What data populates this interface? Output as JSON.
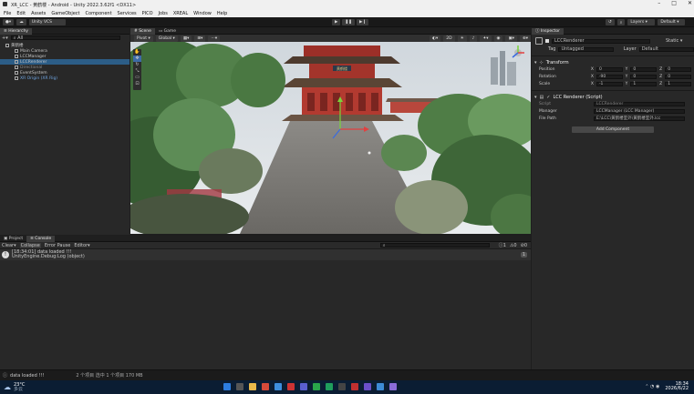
{
  "window": {
    "title": "XR_LCC - 黄鹤楼 - Android - Unity 2022.3.62f1 <DX11>"
  },
  "menu": [
    "File",
    "Edit",
    "Assets",
    "GameObject",
    "Component",
    "Services",
    "PICO",
    "Jobs",
    "XREAL",
    "Window",
    "Help"
  ],
  "toolbar": {
    "account": "Unity VCS",
    "layers": "Layers",
    "layout": "Default"
  },
  "hierarchy": {
    "tab": "Hierarchy",
    "search_placeholder": "All",
    "items": [
      {
        "label": "黄鹤楼",
        "depth": 0
      },
      {
        "label": "Main Camera",
        "depth": 1
      },
      {
        "label": "LCCManager",
        "depth": 1
      },
      {
        "label": "LCCRenderer",
        "depth": 1
      },
      {
        "label": "Directional",
        "depth": 1
      },
      {
        "label": "EventSystem",
        "depth": 1
      },
      {
        "label": "XR Origin (XR Rig)",
        "depth": 1
      }
    ]
  },
  "scene": {
    "tabs": [
      "Scene",
      "Game"
    ],
    "shading": "Pivot",
    "space": "Global",
    "persp": "< Persp",
    "sign_text": "黄鹤楼"
  },
  "inspector": {
    "tab": "Inspector",
    "object_name": "LCCRenderer",
    "static_label": "Static",
    "tag_label": "Tag",
    "tag_value": "Untagged",
    "layer_label": "Layer",
    "layer_value": "Default",
    "transform_title": "Transform",
    "position_label": "Position",
    "rotation_label": "Rotation",
    "scale_label": "Scale",
    "position": [
      "0",
      "0",
      "0"
    ],
    "rotation": [
      "-90",
      "0",
      "0"
    ],
    "scale": [
      "-1",
      "1",
      "1"
    ],
    "axis": [
      "X",
      "Y",
      "Z"
    ],
    "component_title": "LCC Renderer (Script)",
    "script_label": "Script",
    "script_value": "LCCRenderer",
    "manager_label": "Manager",
    "manager_value": "LCCManager (LCC Manager)",
    "filepath_label": "File Path",
    "filepath_value": "E:\\LCC\\黄鹤楼室外\\黄鹤楼室外.lcc",
    "add_component": "Add Component"
  },
  "console": {
    "tabs": [
      "Project",
      "Console"
    ],
    "toolbar": [
      "Clear",
      "Collapse",
      "Error Pause",
      "Editor"
    ],
    "counts": [
      "1",
      "0",
      "0"
    ],
    "entries": [
      {
        "line1": "[18:34:01] data loaded !!!",
        "line2": "UnityEngine.Debug:Log (object)",
        "count": "1"
      }
    ]
  },
  "statusbar": {
    "message": "data loaded !!!"
  },
  "taskbar": {
    "weather_temp": "23°C",
    "weather_desc": "多云",
    "explorer_status": "2 个项目     选中 1 个项目  170 MB",
    "time": "18:34",
    "date": "2026/6/22"
  }
}
